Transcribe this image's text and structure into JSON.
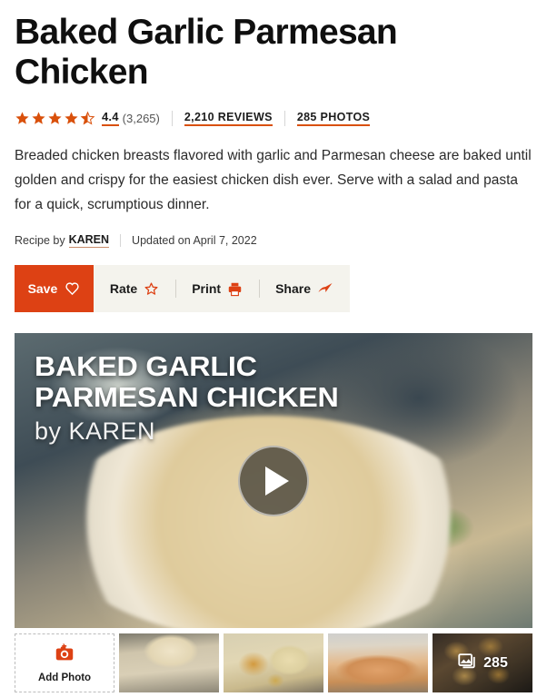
{
  "recipe": {
    "title": "Baked Garlic Parmesan Chicken",
    "description": "Breaded chicken breasts flavored with garlic and Parmesan cheese are baked until golden and crispy for the easiest chicken dish ever. Serve with a salad and pasta for a quick, scrumptious dinner."
  },
  "rating": {
    "value": "4.4",
    "count": "(3,265)",
    "stars_filled": 4,
    "stars_half": 1,
    "stars_total": 5,
    "reviews_link": "2,210 REVIEWS",
    "photos_link": "285 PHOTOS"
  },
  "byline": {
    "prefix": "Recipe by",
    "author": "KAREN",
    "updated": "Updated on April 7, 2022"
  },
  "actions": {
    "save_label": "Save",
    "rate_label": "Rate",
    "print_label": "Print",
    "share_label": "Share",
    "save_color": "#dd4114",
    "bar_color": "#f4f3ed"
  },
  "video": {
    "title_line1": "BAKED GARLIC",
    "title_line2": "PARMESAN CHICKEN",
    "byline": "by KAREN",
    "play_label": "Play video"
  },
  "gallery": {
    "add_photo_label": "Add Photo",
    "thumbnails": [
      {
        "alt": "Chicken and broccoli pasta in a white bowl"
      },
      {
        "alt": "Breaded chicken with rice and potatoes"
      },
      {
        "alt": "Baked chicken breasts in a glass dish"
      },
      {
        "alt": "Golden breaded chicken pieces",
        "count": "285"
      }
    ]
  }
}
